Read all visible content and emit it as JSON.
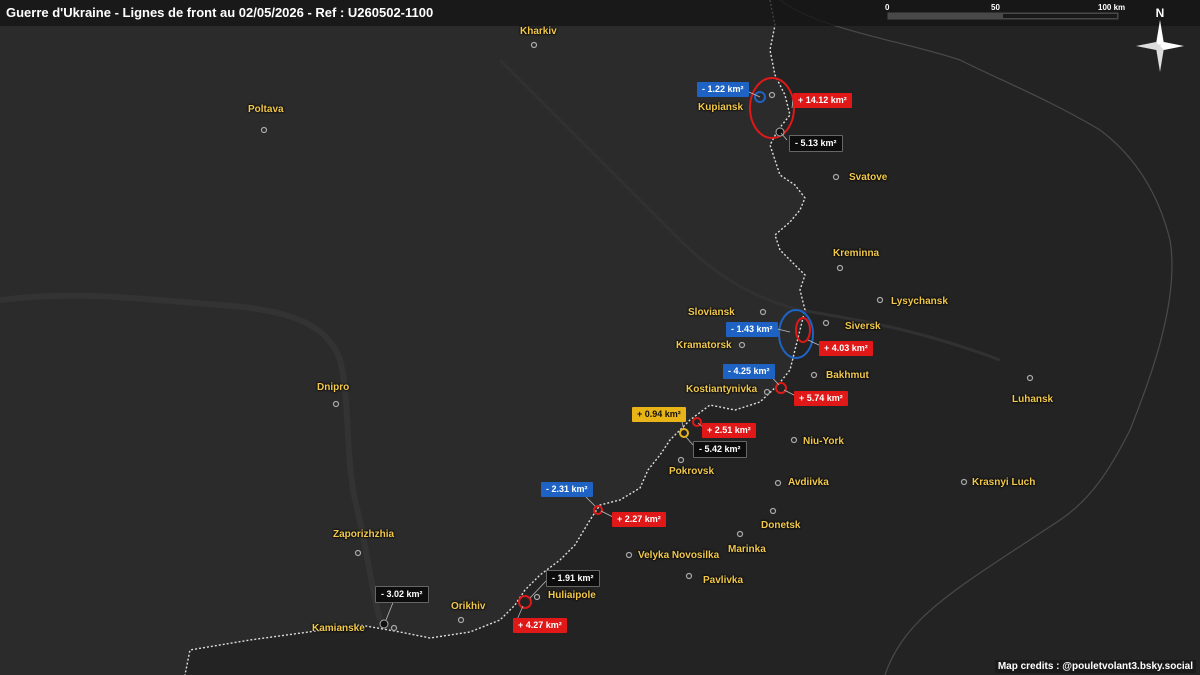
{
  "title": "Guerre d'Ukraine - Lignes de front au 02/05/2026 - Ref : U260502-1100",
  "scale": {
    "labels": [
      "0",
      "50",
      "100 km"
    ]
  },
  "north_label": "N",
  "credits": "Map credits : @pouletvolant3.bsky.social",
  "colors": {
    "ukr_loss": "#1e63c4",
    "rus_gain": "#e01818",
    "city": "#f2c94c",
    "front": "#dddddd"
  },
  "cities": {
    "kharkiv": "Kharkiv",
    "poltava": "Poltava",
    "kupiansk": "Kupiansk",
    "svatove": "Svatove",
    "kreminna": "Kreminna",
    "lysychansk": "Lysychansk",
    "sloviansk": "Sloviansk",
    "siversk": "Siversk",
    "kramatorsk": "Kramatorsk",
    "bakhmut": "Bakhmut",
    "kostiantynivka": "Kostiantynivka",
    "luhansk": "Luhansk",
    "dnipro": "Dnipro",
    "niu_york": "Niu-York",
    "pokrovsk": "Pokrovsk",
    "avdiivka": "Avdiivka",
    "krasnyi_luch": "Krasnyi Luch",
    "donetsk": "Donetsk",
    "zaporizhzhia": "Zaporizhzhia",
    "marinka": "Marinka",
    "velyka_novosilka": "Velyka Novosilka",
    "pavlivka": "Pavlivka",
    "huliaipole": "Huliaipole",
    "orikhiv": "Orikhiv",
    "kamianske": "Kamianske"
  },
  "badges": {
    "kupiansk_loss": "- 1.22 km²",
    "kupiansk_gain": "+ 14.12 km²",
    "kupiansk_black": "- 5.13 km²",
    "siversk_loss": "- 1.43 km²",
    "siversk_gain": "+ 4.03 km²",
    "bakhmut_loss": "- 4.25 km²",
    "bakhmut_gain": "+ 5.74 km²",
    "pokrovsk_yellow": "+ 0.94 km²",
    "pokrovsk_gain": "+ 2.51 km²",
    "pokrovsk_black": "- 5.42 km²",
    "vn_loss": "- 2.31 km²",
    "vn_gain": "+ 2.27 km²",
    "hulia_black": "- 1.91 km²",
    "hulia_gain": "+ 4.27 km²",
    "kamianske_black": "- 3.02 km²"
  }
}
